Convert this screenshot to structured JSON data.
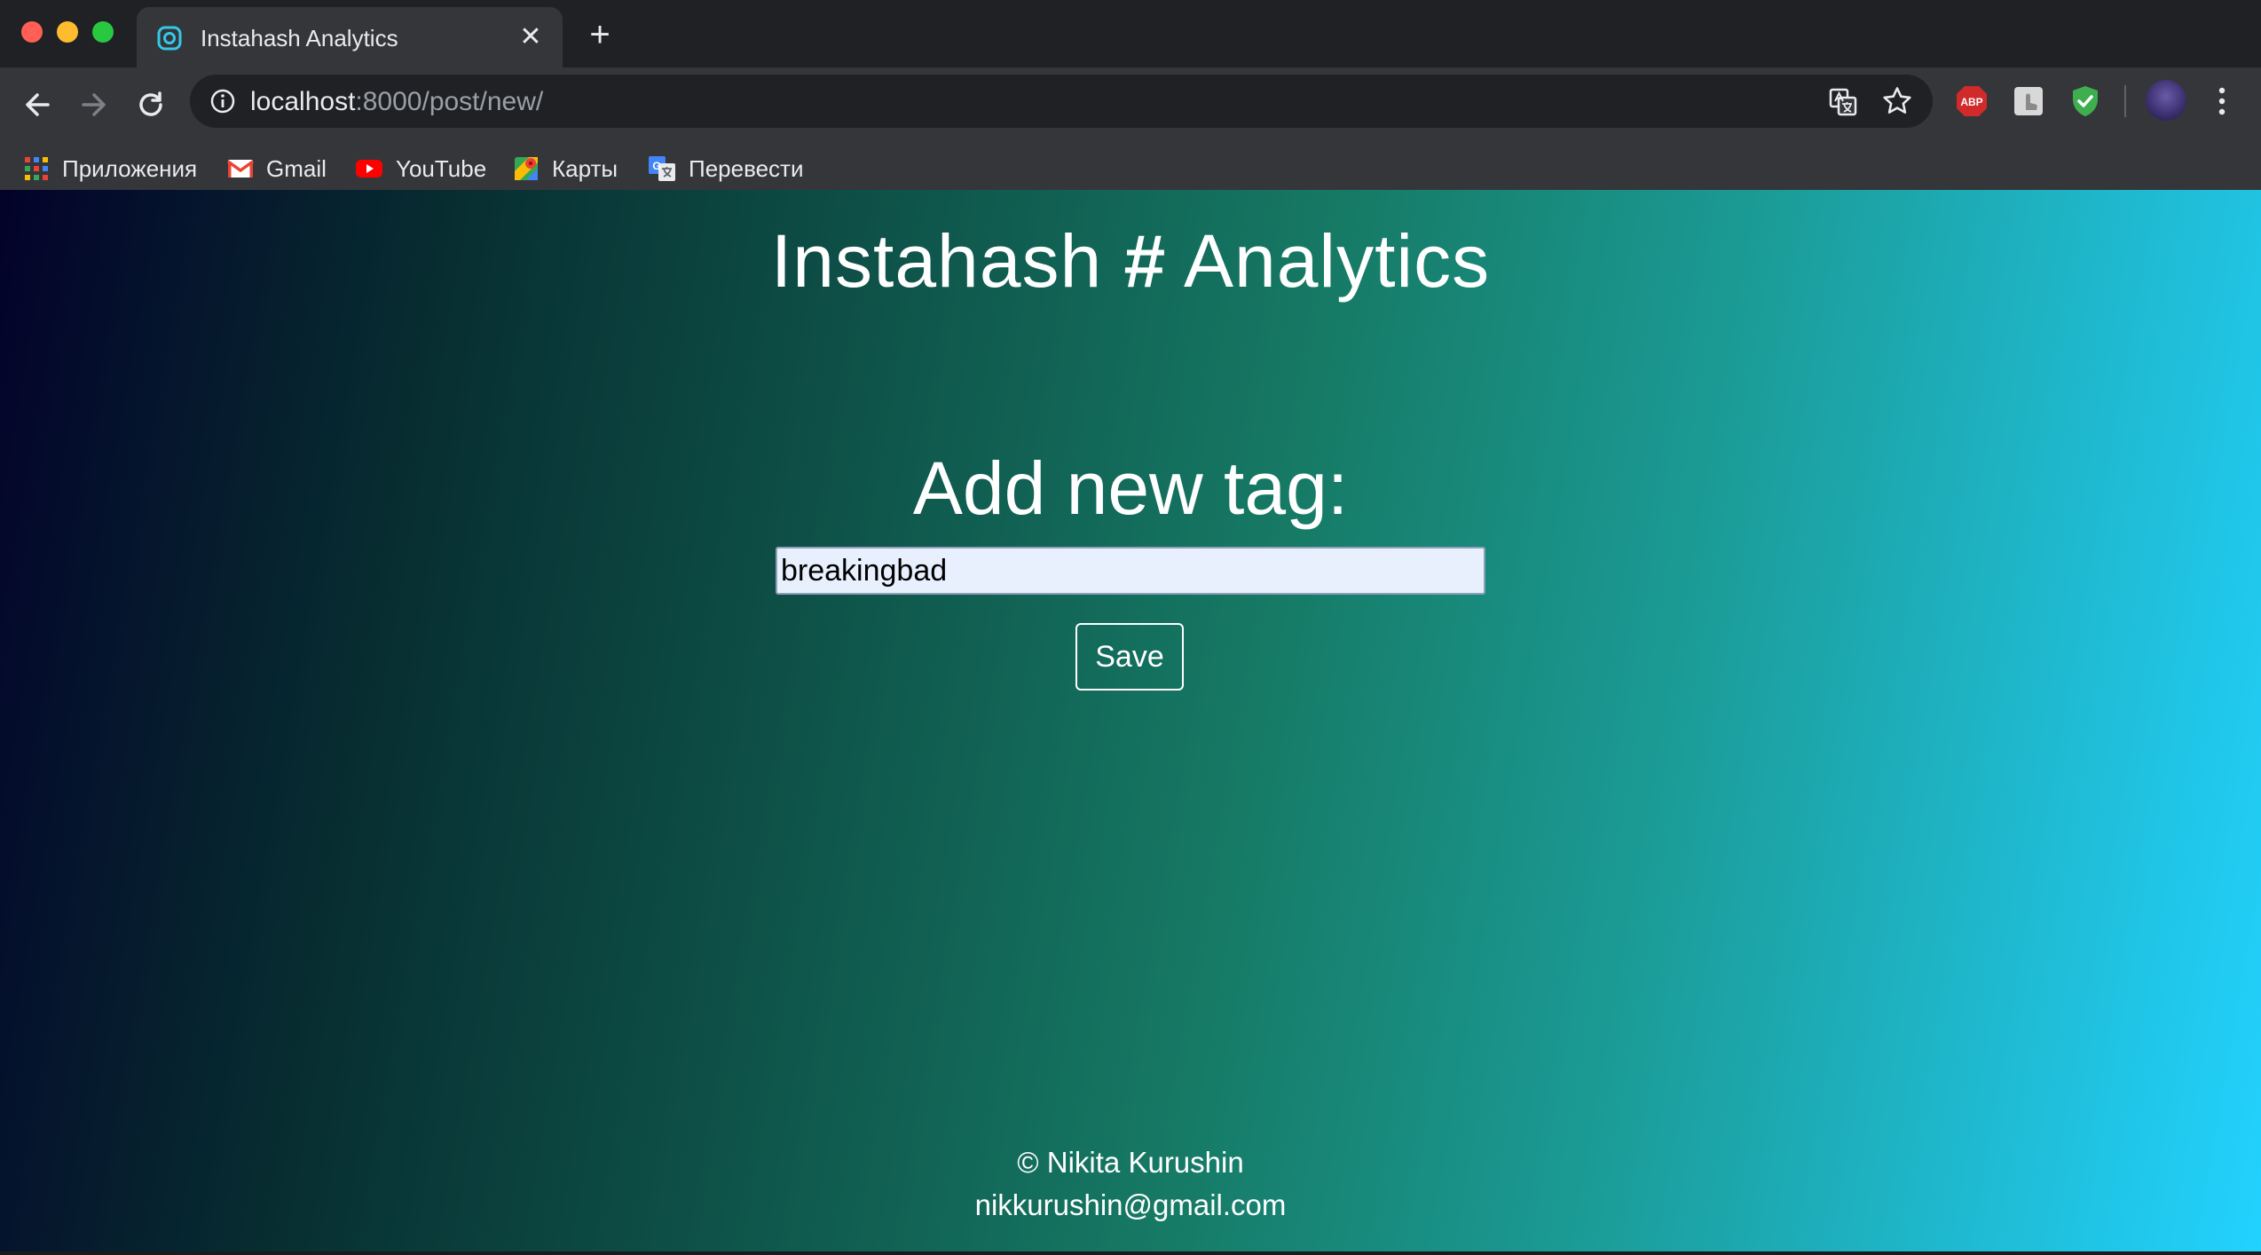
{
  "browser": {
    "tab": {
      "title": "Instahash Analytics",
      "close": "✕"
    },
    "new_tab": "+",
    "url": {
      "host": "localhost",
      "rest": ":8000/post/new/"
    },
    "extensions": [
      "translate-icon",
      "star-icon",
      "adblock-icon",
      "touch-icon",
      "shield-icon"
    ],
    "bookmarks": [
      {
        "label": "Приложения",
        "icon": "apps-grid-icon"
      },
      {
        "label": "Gmail",
        "icon": "gmail-icon"
      },
      {
        "label": "YouTube",
        "icon": "youtube-icon"
      },
      {
        "label": "Карты",
        "icon": "maps-icon"
      },
      {
        "label": "Перевести",
        "icon": "translate-icon"
      }
    ],
    "abp_text": "ABP"
  },
  "page": {
    "title_left": "Instahash ",
    "title_hash": "#",
    "title_right": " Analytics",
    "form_title": "Add new tag:",
    "tag_input_value": "breakingbad",
    "save_label": "Save",
    "footer": {
      "copyright": "© Nikita Kurushin",
      "email": "nikkurushin@gmail.com"
    }
  },
  "colors": {
    "chrome_dark": "#202124",
    "chrome_toolbar": "#35363a",
    "gradient_start": "#03022a",
    "gradient_end": "#22d2ff"
  }
}
